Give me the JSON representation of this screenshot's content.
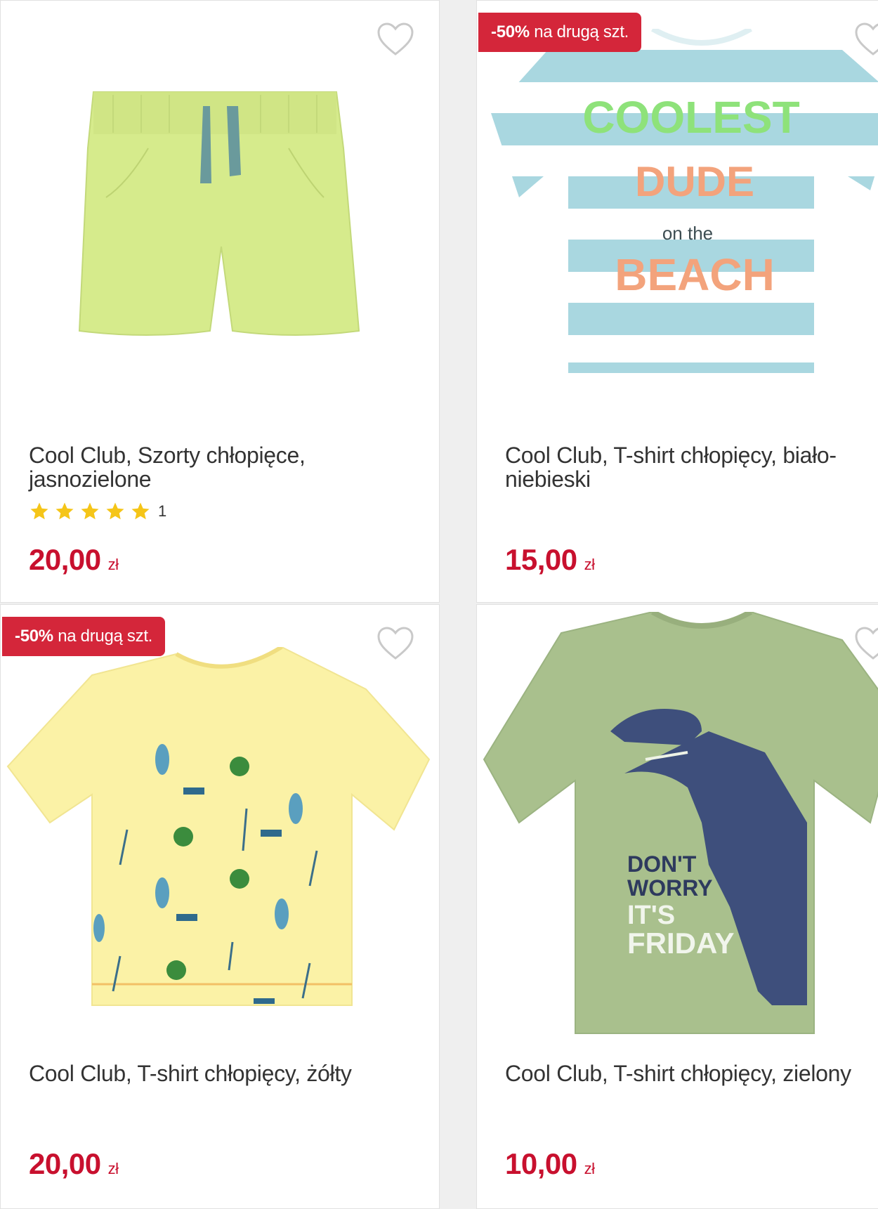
{
  "products": [
    {
      "title": "Cool Club, Szorty chłopięce, jasnozielone",
      "rating_count": "1",
      "stars": 5,
      "price": "20,00",
      "currency": "zł",
      "badge": null
    },
    {
      "title": "Cool Club, T-shirt chłopięcy, biało-niebieski",
      "price": "15,00",
      "currency": "zł",
      "badge": {
        "pct": "-50%",
        "text": "na drugą szt."
      },
      "print_lines": [
        "COOLEST",
        "DUDE",
        "on the",
        "BEACH"
      ]
    },
    {
      "title": "Cool Club, T-shirt chłopięcy, żółty",
      "price": "20,00",
      "currency": "zł",
      "badge": {
        "pct": "-50%",
        "text": "na drugą szt."
      }
    },
    {
      "title": "Cool Club, T-shirt chłopięcy, zielony",
      "price": "10,00",
      "currency": "zł",
      "badge": null,
      "print_lines": [
        "DON'T",
        "WORRY",
        "IT'S",
        "FRIDAY"
      ]
    }
  ],
  "colors": {
    "price": "#c8102e",
    "badge": "#d4263a",
    "star": "#f5c518"
  },
  "icons": [
    "heart-icon",
    "star-icon"
  ]
}
